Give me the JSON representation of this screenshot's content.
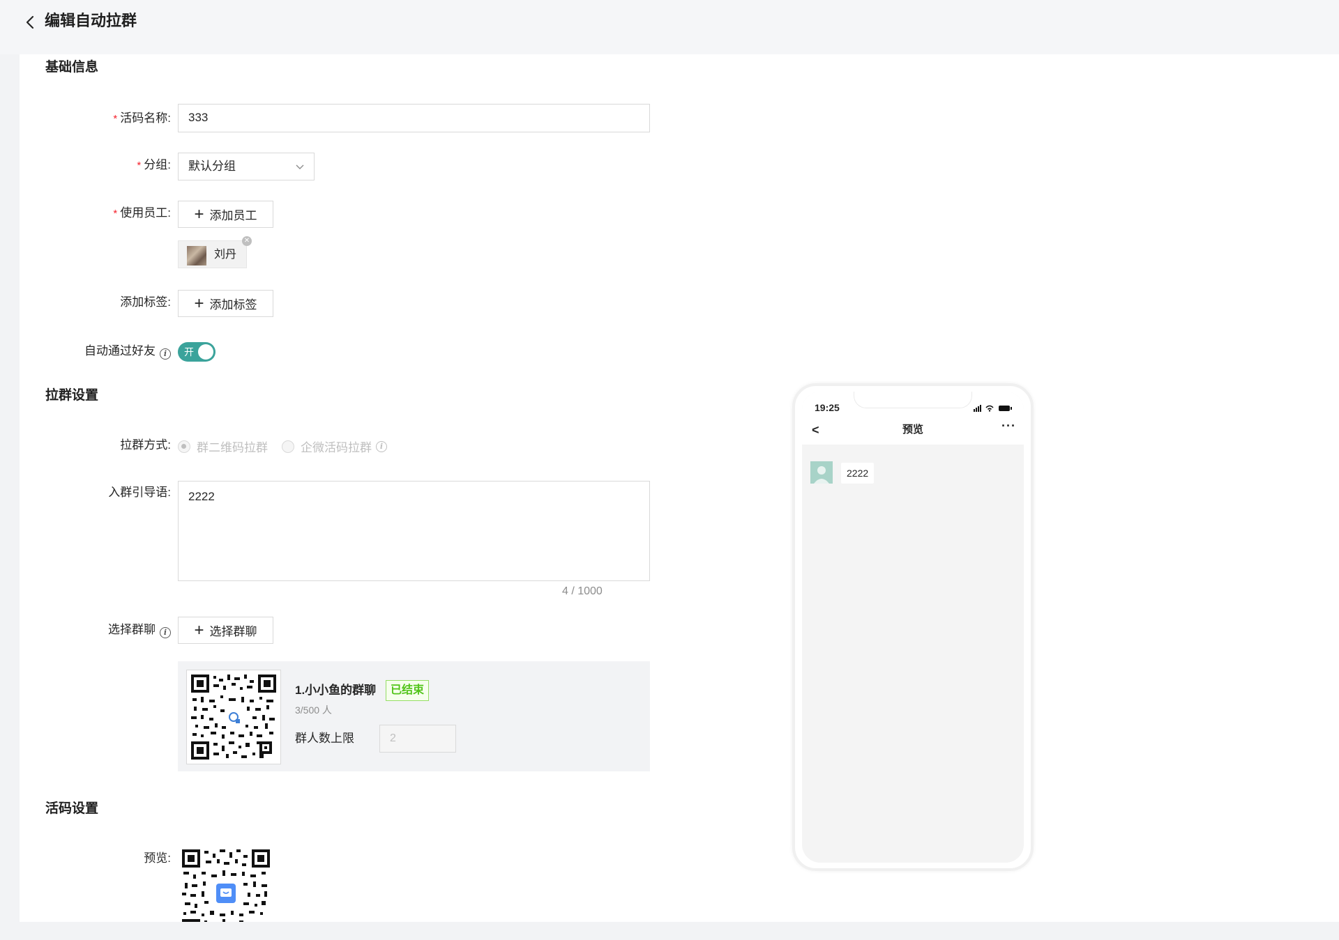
{
  "header": {
    "title": "编辑自动拉群"
  },
  "sections": {
    "basic": "基础信息",
    "group": "拉群设置",
    "code": "活码设置"
  },
  "form": {
    "name": {
      "label": "活码名称:",
      "value": "333"
    },
    "group": {
      "label": "分组:",
      "value": "默认分组"
    },
    "staff": {
      "label": "使用员工:",
      "button": "添加员工",
      "employee": "刘丹"
    },
    "tags": {
      "label": "添加标签:",
      "button": "添加标签"
    },
    "auto_accept": {
      "label": "自动通过好友",
      "switch_text": "开"
    },
    "method": {
      "label": "拉群方式:",
      "option1": "群二维码拉群",
      "option2": "企微活码拉群"
    },
    "guide": {
      "label": "入群引导语:",
      "value": "2222",
      "counter": "4 / 1000"
    },
    "chat": {
      "label": "选择群聊",
      "button": "选择群聊"
    },
    "preview": {
      "label": "预览:"
    }
  },
  "group_card": {
    "name": "1.小小鱼的群聊",
    "status": "已结束",
    "count": "3/500 人",
    "limit_label": "群人数上限",
    "limit_value": "2"
  },
  "colors": {
    "accent": "#3ba39b",
    "required": "#f5222d",
    "success": "#52c41a"
  },
  "phone": {
    "time": "19:25",
    "title": "预览",
    "back": "<",
    "more": "···",
    "message": "2222"
  }
}
